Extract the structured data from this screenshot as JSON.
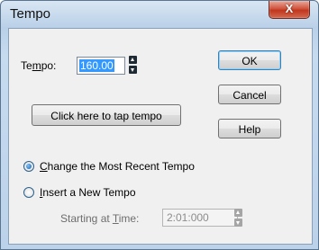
{
  "window": {
    "title": "Tempo",
    "close_glyph": "X"
  },
  "tempo": {
    "label_pre": "Te",
    "label_u": "m",
    "label_post": "po:",
    "value": "160.00"
  },
  "buttons": {
    "ok": "OK",
    "cancel": "Cancel",
    "help": "Help",
    "tap": "Click here to tap tempo"
  },
  "options": {
    "change_u": "C",
    "change_rest": "hange the Most Recent Tempo",
    "change_selected": true,
    "insert_u": "I",
    "insert_rest": "nsert a New Tempo",
    "insert_selected": false
  },
  "starting": {
    "label_pre": "Starting at ",
    "label_u": "T",
    "label_post": "ime:",
    "value": "2:01:000"
  },
  "icons": {
    "close": "close-icon",
    "spin_up": "arrow-up-icon",
    "spin_down": "arrow-down-icon"
  }
}
